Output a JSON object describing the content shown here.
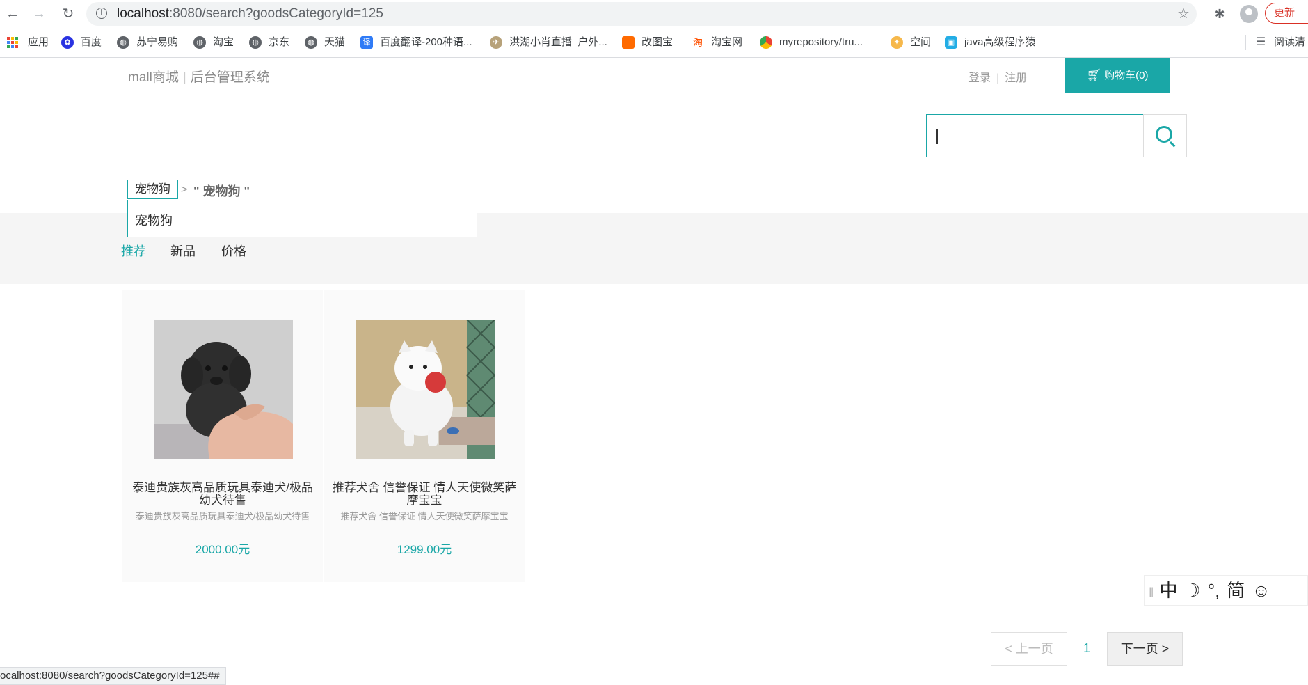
{
  "browser": {
    "url_host": "localhost",
    "url_rest": ":8080/search?goodsCategoryId=125",
    "update_label": "更新",
    "status_url": "ocalhost:8080/search?goodsCategoryId=125##"
  },
  "bookmarks": [
    {
      "label": "应用",
      "icon": "apps-grid-icon"
    },
    {
      "label": "百度",
      "icon": "baidu-paw-icon"
    },
    {
      "label": "苏宁易购",
      "icon": "globe-icon"
    },
    {
      "label": "淘宝",
      "icon": "globe-icon"
    },
    {
      "label": "京东",
      "icon": "globe-icon"
    },
    {
      "label": "天猫",
      "icon": "globe-icon"
    },
    {
      "label": "百度翻译-200种语...",
      "icon": "translate-icon"
    },
    {
      "label": "洪湖小肖直播_户外...",
      "icon": "bird-icon"
    },
    {
      "label": "改图宝",
      "icon": "orange-square-icon"
    },
    {
      "label": "淘宝网",
      "icon": "taobao-icon"
    },
    {
      "label": "myrepository/tru...",
      "icon": "chrome-icon"
    },
    {
      "label": "空间",
      "icon": "qzone-icon"
    },
    {
      "label": "java高级程序猿",
      "icon": "bilibili-icon"
    },
    {
      "label": "阅读清",
      "icon": "reading-list-icon"
    }
  ],
  "header": {
    "brand": "mall商城",
    "admin": "后台管理系统",
    "login": "登录",
    "register": "注册",
    "cart": "购物车(0)"
  },
  "search": {
    "value": ""
  },
  "breadcrumb": {
    "tag": "宠物狗",
    "separator": ">",
    "current": "\" 宠物狗 \""
  },
  "dropdown": {
    "items": [
      "宠物狗"
    ]
  },
  "sort_tabs": [
    {
      "label": "推荐",
      "active": true
    },
    {
      "label": "新品",
      "active": false
    },
    {
      "label": "价格",
      "active": false
    }
  ],
  "products": [
    {
      "name": "泰迪贵族灰高品质玩具泰迪犬/极品幼犬待售",
      "desc": "泰迪贵族灰高品质玩具泰迪犬/极品幼犬待售",
      "price": "2000.00元"
    },
    {
      "name": "推荐犬舍 信誉保证 情人天使微笑萨摩宝宝",
      "desc": "推荐犬舍 信誉保证 情人天使微笑萨摩宝宝",
      "price": "1299.00元"
    }
  ],
  "ime": [
    "中",
    "☽",
    "°,",
    "简",
    "☺"
  ],
  "pagination": {
    "prev": "< 上一页",
    "current": "1",
    "next": "下一页 >"
  },
  "colors": {
    "accent": "#1aa7a7",
    "band": "#f5f5f5"
  }
}
